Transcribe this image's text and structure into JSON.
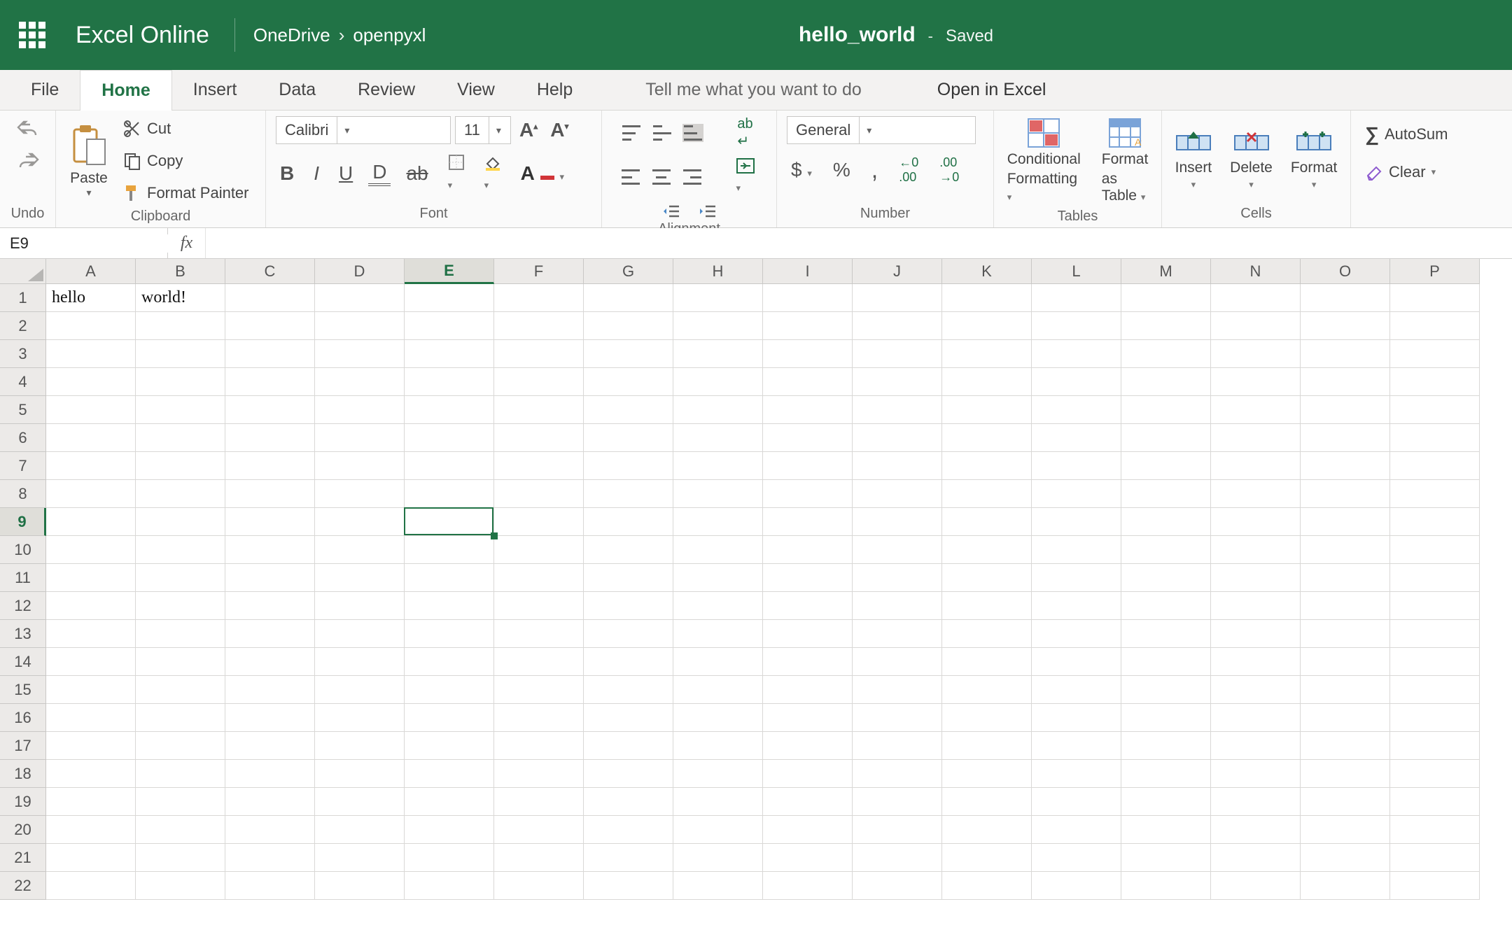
{
  "titlebar": {
    "app_name": "Excel Online",
    "breadcrumb": [
      "OneDrive",
      "openpyxl"
    ],
    "doc_title": "hello_world",
    "status": "Saved"
  },
  "tabs": {
    "items": [
      "File",
      "Home",
      "Insert",
      "Data",
      "Review",
      "View",
      "Help"
    ],
    "active_index": 1,
    "tell_me_placeholder": "Tell me what you want to do",
    "open_in_excel": "Open in Excel"
  },
  "ribbon": {
    "undo_label": "Undo",
    "clipboard": {
      "paste": "Paste",
      "cut": "Cut",
      "copy": "Copy",
      "format_painter": "Format Painter",
      "group_label": "Clipboard"
    },
    "font": {
      "name": "Calibri",
      "size": "11",
      "group_label": "Font"
    },
    "alignment": {
      "group_label": "Alignment",
      "wrap": "ab"
    },
    "number": {
      "format": "General",
      "group_label": "Number"
    },
    "tables": {
      "conditional_line1": "Conditional",
      "conditional_line2": "Formatting",
      "format_table_line1": "Format",
      "format_table_line2": "as Table",
      "group_label": "Tables"
    },
    "cells": {
      "insert": "Insert",
      "delete": "Delete",
      "format": "Format",
      "group_label": "Cells"
    },
    "editing": {
      "autosum": "AutoSum",
      "clear": "Clear"
    }
  },
  "fxbar": {
    "name_box": "E9",
    "fx_label": "fx",
    "formula_value": ""
  },
  "grid": {
    "columns": [
      "A",
      "B",
      "C",
      "D",
      "E",
      "F",
      "G",
      "H",
      "I",
      "J",
      "K",
      "L",
      "M",
      "N",
      "O",
      "P"
    ],
    "row_count": 22,
    "selected_col_index": 4,
    "selected_row_index": 8,
    "cells": {
      "A1": "hello",
      "B1": "world!"
    }
  }
}
